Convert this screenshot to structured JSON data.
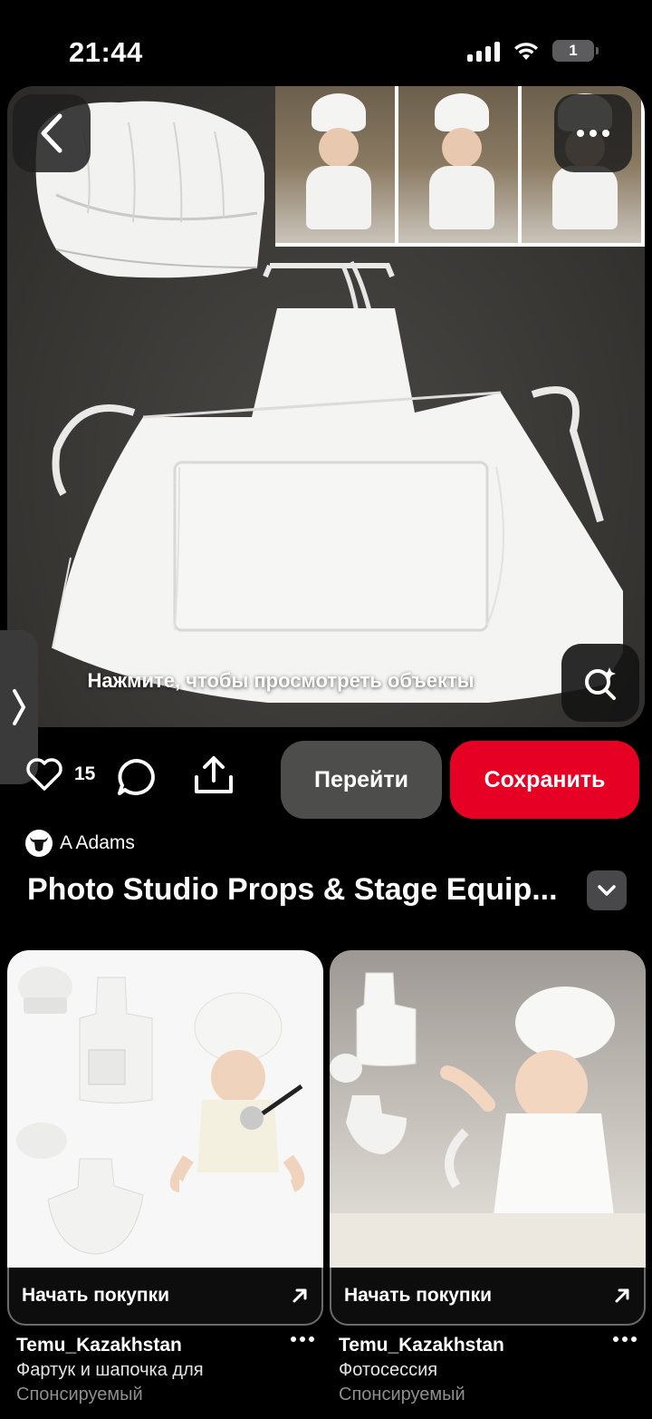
{
  "status_bar": {
    "time": "21:44",
    "battery_level": "1",
    "icons": [
      "signal-icon",
      "wifi-icon",
      "battery-icon"
    ]
  },
  "pin": {
    "objects_hint": "Нажмите, чтобы просмотреть объекты",
    "like_count": "15",
    "visit_label": "Перейти",
    "save_label": "Сохранить",
    "author": "A Adams",
    "title": "Photo Studio Props & Stage Equip..."
  },
  "colors": {
    "save_button": "#e60023",
    "visit_button": "#4d4d4b",
    "background": "#000000"
  },
  "cards": [
    {
      "cta_label": "Начать покупки",
      "source": "Temu_Kazakhstan",
      "description": "Фартук и шапочка для",
      "sponsored": "Спонсируемый"
    },
    {
      "cta_label": "Начать покупки",
      "source": "Temu_Kazakhstan",
      "description": "Фотосессия",
      "sponsored": "Спонсируемый"
    }
  ]
}
